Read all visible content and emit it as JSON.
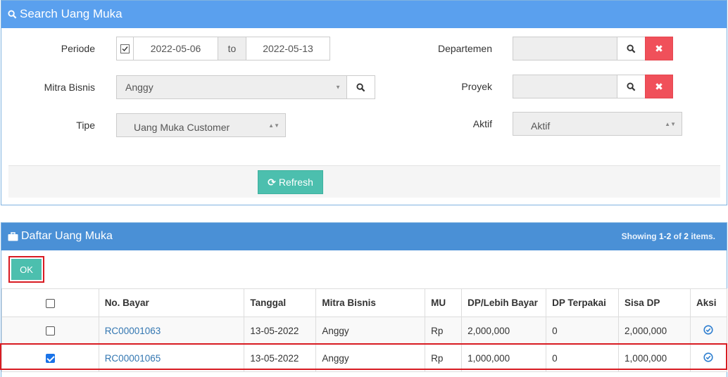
{
  "search": {
    "title": "Search Uang Muka",
    "periode_label": "Periode",
    "periode_checked": true,
    "date_from": "2022-05-06",
    "to_label": "to",
    "date_to": "2022-05-13",
    "mitra_label": "Mitra Bisnis",
    "mitra_value": "Anggy",
    "tipe_label": "Tipe",
    "tipe_value": "Uang Muka Customer",
    "departemen_label": "Departemen",
    "departemen_value": "",
    "proyek_label": "Proyek",
    "proyek_value": "",
    "aktif_label": "Aktif",
    "aktif_value": "Aktif",
    "refresh_label": "Refresh"
  },
  "list": {
    "title": "Daftar Uang Muka",
    "showing_prefix": "Showing ",
    "showing_range": "1-2",
    "showing_of": " of ",
    "showing_total": "2",
    "showing_suffix": " items.",
    "ok_label": "OK",
    "columns": [
      "No. Bayar",
      "Tanggal",
      "Mitra Bisnis",
      "MU",
      "DP/Lebih Bayar",
      "DP Terpakai",
      "Sisa DP",
      "Aksi"
    ],
    "rows": [
      {
        "checked": false,
        "no_bayar": "RC00001063",
        "tanggal": "13-05-2022",
        "mitra": "Anggy",
        "mu": "Rp",
        "dp": "2,000,000",
        "terpakai": "0",
        "sisa": "2,000,000"
      },
      {
        "checked": true,
        "no_bayar": "RC00001065",
        "tanggal": "13-05-2022",
        "mitra": "Anggy",
        "mu": "Rp",
        "dp": "1,000,000",
        "terpakai": "0",
        "sisa": "1,000,000"
      }
    ]
  },
  "colors": {
    "header_blue": "#5aa0ee",
    "teal": "#4cbfae",
    "danger": "#f0505a",
    "highlight": "#d81b22",
    "link": "#3276b1"
  }
}
